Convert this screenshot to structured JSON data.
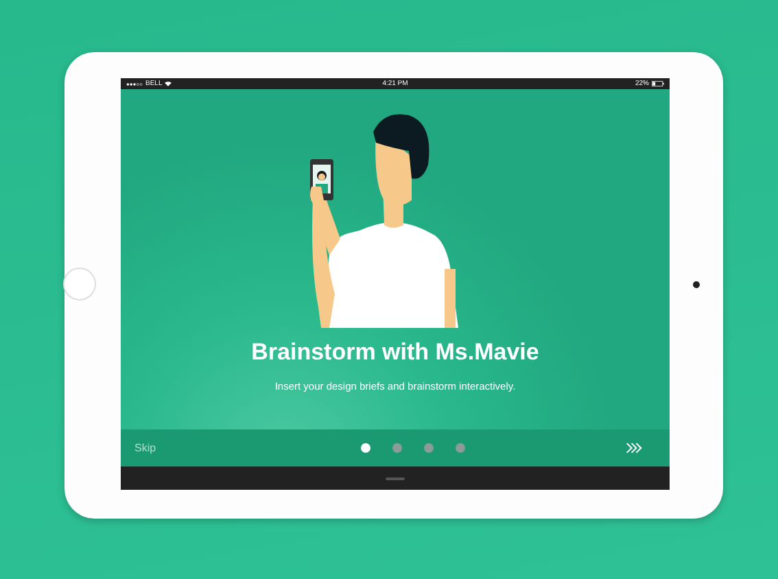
{
  "status_bar": {
    "carrier": "BELL",
    "time": "4:21 PM",
    "battery": "22%"
  },
  "onboarding": {
    "title": "Brainstorm with Ms.Mavie",
    "subtitle": "Insert your design briefs and brainstorm interactively."
  },
  "footer": {
    "skip": "Skip",
    "pages": [
      {
        "selected": true
      },
      {
        "selected": false
      },
      {
        "selected": false
      },
      {
        "selected": false
      }
    ]
  }
}
